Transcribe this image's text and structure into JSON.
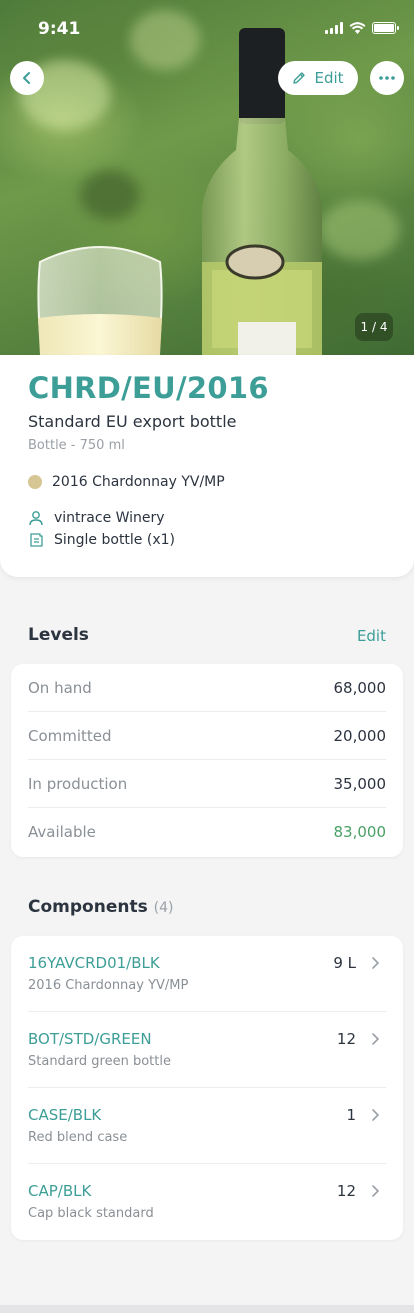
{
  "status_bar": {
    "time": "9:41"
  },
  "hero": {
    "edit_label": "Edit",
    "pager": "1 / 4",
    "icons": {
      "back": "chevron-left-icon",
      "edit": "pencil-icon",
      "more": "more-dots-icon"
    }
  },
  "product": {
    "code": "CHRD/EU/2016",
    "name": "Standard EU export bottle",
    "format": "Bottle - 750 ml",
    "wine": "2016 Chardonnay YV/MP",
    "wine_color": "#d6c693",
    "owner": "vintrace Winery",
    "packaging": "Single bottle (x1)"
  },
  "levels": {
    "title": "Levels",
    "edit_label": "Edit",
    "rows": [
      {
        "label": "On hand",
        "value": "68,000"
      },
      {
        "label": "Committed",
        "value": "20,000"
      },
      {
        "label": "In production",
        "value": "35,000"
      },
      {
        "label": "Available",
        "value": "83,000"
      }
    ],
    "available_color": "#4aa065"
  },
  "components": {
    "title": "Components",
    "count": "(4)",
    "items": [
      {
        "code": "16YAVCRD01/BLK",
        "description": "2016 Chardonnay YV/MP",
        "qty": "9 L"
      },
      {
        "code": "BOT/STD/GREEN",
        "description": "Standard green bottle",
        "qty": "12"
      },
      {
        "code": "CASE/BLK",
        "description": "Red blend case",
        "qty": "1"
      },
      {
        "code": "CAP/BLK",
        "description": "Cap black standard",
        "qty": "12"
      }
    ]
  },
  "colors": {
    "accent": "#3d9e97",
    "text": "#2c3440",
    "muted": "#8a9096"
  }
}
